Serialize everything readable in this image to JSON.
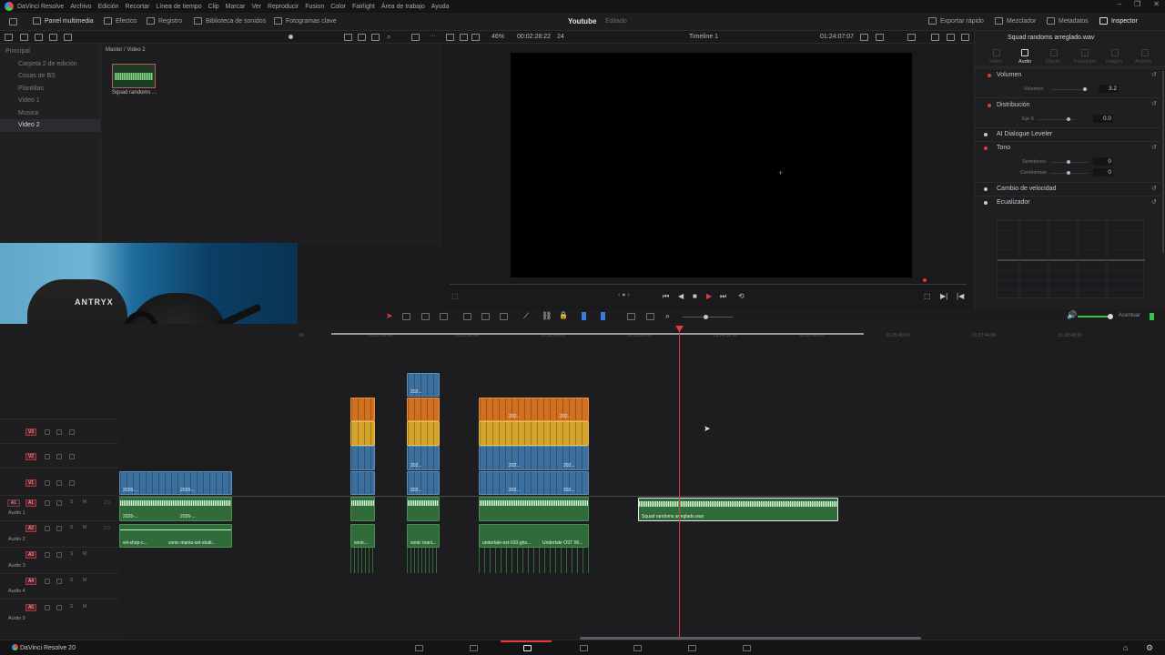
{
  "menu": {
    "app": "DaVinci Resolve",
    "items": [
      "Archivo",
      "Edición",
      "Recortar",
      "Línea de tiempo",
      "Clip",
      "Marcar",
      "Ver",
      "Reproducir",
      "Fusion",
      "Color",
      "Fairlight",
      "Área de trabajo",
      "Ayuda"
    ]
  },
  "toolbar": {
    "media_panel": "Panel multimedia",
    "effects": "Efectos",
    "log": "Registro",
    "sound_library": "Biblioteca de sonidos",
    "keyframes": "Fotogramas clave",
    "project_title": "Youtube",
    "project_status": "Editado",
    "quick_export": "Exportar rápido",
    "mixer": "Mezclador",
    "metadata": "Metadatos",
    "inspector": "Inspector"
  },
  "viewer": {
    "zoom": "46%",
    "duration": "00:02:28:22",
    "fps": "24",
    "timeline_name": "Timeline 1",
    "timecode": "01:24:07:07"
  },
  "media_pool": {
    "path": "Master / Video 2",
    "clip_name": "Squad randoms ...",
    "bins": [
      {
        "name": "Principal",
        "root": true,
        "selected": false
      },
      {
        "name": "Carpeta 2 de edición",
        "root": false,
        "selected": false
      },
      {
        "name": "Cosas de BS",
        "root": false,
        "selected": false
      },
      {
        "name": "Plantillas",
        "root": false,
        "selected": false
      },
      {
        "name": "Video 1",
        "root": false,
        "selected": false
      },
      {
        "name": "Musica",
        "root": false,
        "selected": false
      },
      {
        "name": "Video 2",
        "root": false,
        "selected": true
      }
    ]
  },
  "webcam": {
    "chair_brand": "ANTRYX"
  },
  "inspector": {
    "clip_title": "Squad randoms arreglado.wav",
    "tabs": [
      "Video",
      "Audio",
      "Efecto",
      "Transición",
      "Imagen",
      "Archivo"
    ],
    "active_tab": "Audio",
    "sections": {
      "volume": "Volumen",
      "volume_param": "Volumen",
      "volume_value": "3.2",
      "distribution": "Distribución",
      "eje_x": "Eje X",
      "eje_x_value": "0.0",
      "ai_leveler": "AI Dialogue Leveler",
      "pitch": "Tono",
      "semitones": "Semitonos",
      "semitones_value": "0",
      "cents": "Centésimas",
      "cents_value": "0",
      "speed_change": "Cambio de velocidad",
      "equalizer": "Ecualizador"
    },
    "eq_labels": [
      "+",
      "+",
      "+",
      "+",
      "-",
      "-",
      "-",
      "-"
    ]
  },
  "timeline": {
    "ruler_labels": [
      "01:20:16:00",
      "01:21:20:00",
      "01:22:24:00",
      "01:23:28:00",
      "01:24:32:00",
      "01:25:36:00",
      "01:26:40:00",
      "01:27:44:00",
      "01:28:48:00"
    ],
    "ruler_first": ":00",
    "tracks": {
      "v3": "V3",
      "v2": "V2",
      "v1": "V1",
      "a1": "A1",
      "a2": "A2",
      "a3": "A3",
      "a4": "A4",
      "a5": "A5",
      "audio1": "Audio 1",
      "audio2": "Audio 2",
      "audio3": "Audio 3",
      "audio4": "Audio 4",
      "audio5": "Audio 5",
      "vol": "2.0"
    },
    "clips": {
      "v1_a": "2026-...",
      "v1_b": "2026-...",
      "a1_a": "2026-...",
      "a1_b": "2026-...",
      "a2_a": "wii-shop-c...",
      "a2_b": "sonic-mania-ost-studi...",
      "a2_c": "sonic...",
      "a2_d": "sonic mani...",
      "a2_e": "undertale-ost-010-gho...",
      "a2_f": "Undertale OST 06...",
      "v_mid": "202...",
      "squad": "Squad randoms arreglado.wav"
    },
    "monitor_label": "Acentuar"
  },
  "bottom": {
    "app_name": "DaVinci Resolve 20"
  }
}
